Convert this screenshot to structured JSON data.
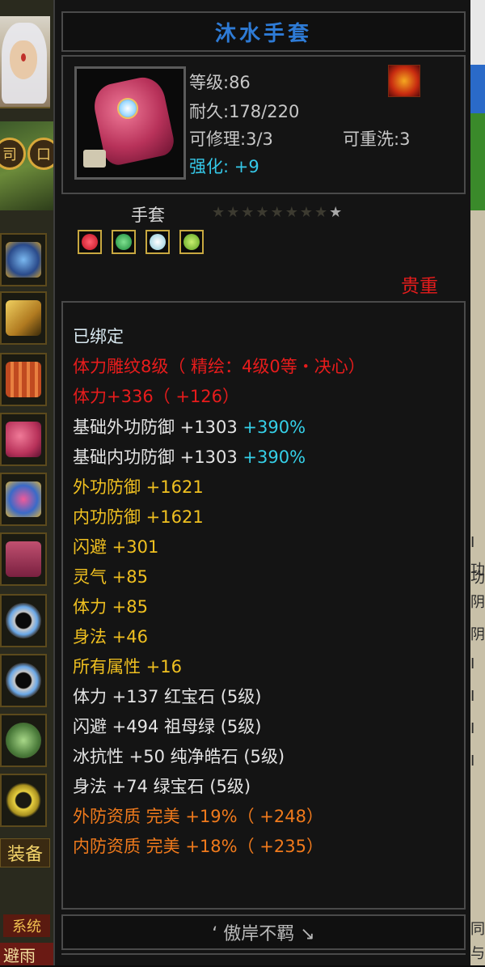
{
  "item": {
    "name": "沐水手套",
    "level_label": "等级",
    "level_value": ":86",
    "durability_label": "耐久",
    "durability_value": ":178/220",
    "repair_label": "可修理",
    "repair_value": ":3/3",
    "rewash_label": "可重洗",
    "rewash_value": ":3",
    "enhance_label": "强化:",
    "enhance_value": "+9",
    "type": "手套",
    "stars_total": 9,
    "stars_lit": 1,
    "rarity": "贵重",
    "sockets": [
      {
        "name": "红宝石",
        "color": "#e01c30"
      },
      {
        "name": "祖母绿",
        "color": "#2ea84a"
      },
      {
        "name": "纯净皓石",
        "color": "#b8e8f0"
      },
      {
        "name": "绿宝石",
        "color": "#7ac832"
      }
    ]
  },
  "attributes": {
    "bound": "已绑定",
    "engrave": "体力雕纹8级（ 精绘：4级0等・决心）",
    "stamina_total": "体力+336（ +126）",
    "base_ext_def": "基础外功防御 +1303",
    "base_ext_def_pct": "+390%",
    "base_int_def": "基础内功防御 +1303",
    "base_int_def_pct": "+390%",
    "ext_def": "外功防御 +1621",
    "int_def": "内功防御 +1621",
    "dodge": "闪避 +301",
    "spirit": "灵气 +85",
    "stamina": "体力 +85",
    "agility": "身法 +46",
    "all_attr": "所有属性 +16",
    "gem1": "体力 +137 红宝石 (5级)",
    "gem2": "闪避 +494 祖母绿 (5级)",
    "gem3": "冰抗性 +50 纯净皓石 (5级)",
    "gem4": "身法 +74 绿宝石 (5级)",
    "quality1": "外防资质  完美 +19%（ +248）",
    "quality2": "内防资质  完美 +18%（ +235）"
  },
  "footer": "‘ 傲岸不羁 ↘",
  "sidebar": {
    "equip_label": "装备",
    "system_label": "系统",
    "rain_label": "避雨",
    "round_btn_1": "司",
    "round_btn_2": "口"
  },
  "rightbar": {
    "chars": [
      "I",
      "功",
      "功",
      "阴",
      "阴",
      "I",
      "I",
      "I",
      "I",
      "同",
      "与"
    ]
  },
  "colors": {
    "title": "#2e7bd6",
    "rarity_red": "#e81c1c",
    "stat_yellow": "#f0c020",
    "stat_cyan": "#35d0e8",
    "quality_orange": "#f07a1c"
  }
}
